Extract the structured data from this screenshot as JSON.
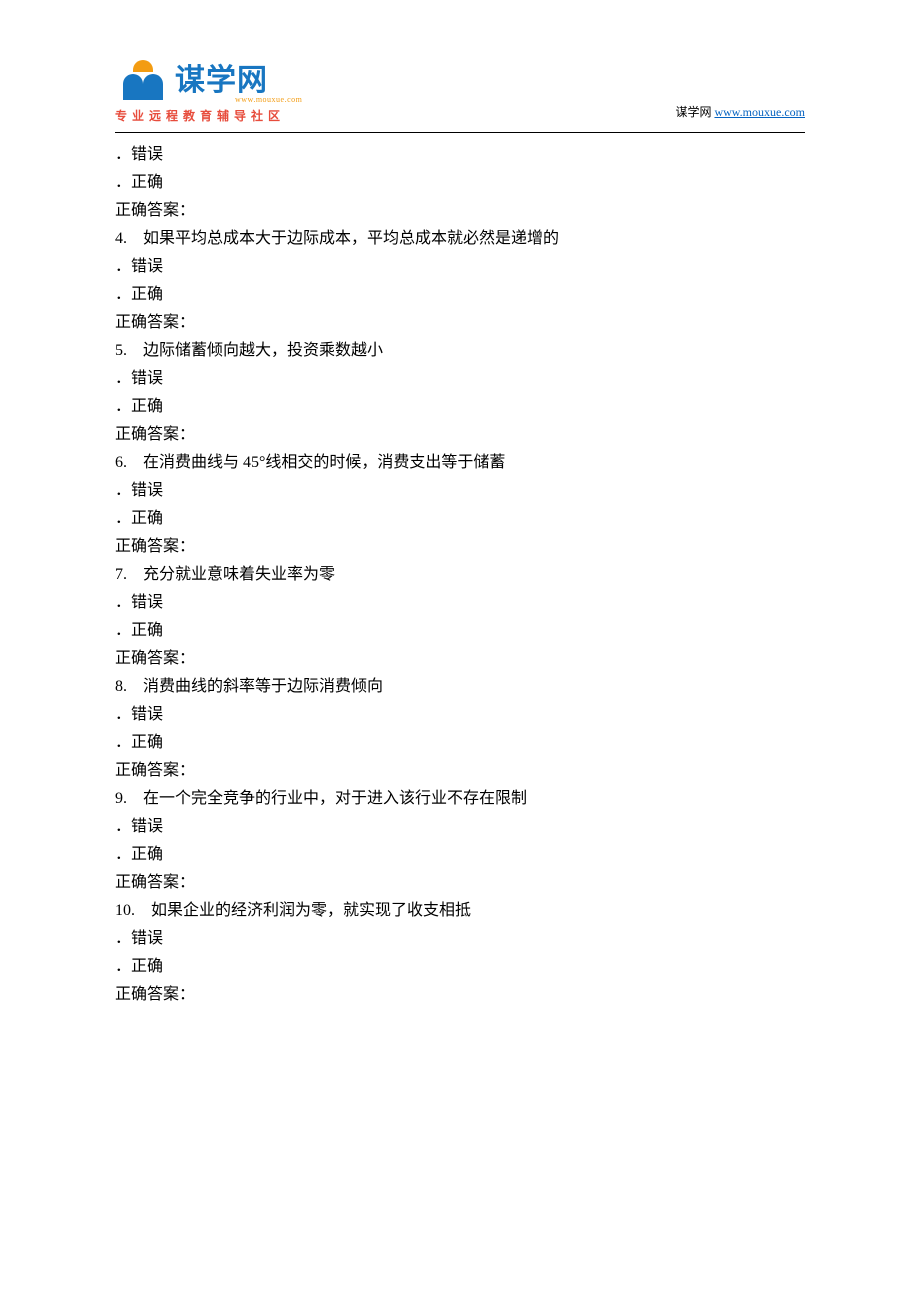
{
  "header": {
    "logo_text": "谋学网",
    "logo_url_small": "www.mouxue.com",
    "tagline": "专业远程教育辅导社区",
    "attribution_prefix": "谋学网 ",
    "attribution_link": "www.mouxue.com"
  },
  "questions": [
    {
      "opt_false": "．错误",
      "opt_true": "．正确",
      "answer_label": "正确答案："
    },
    {
      "stem": "4.　如果平均总成本大于边际成本，平均总成本就必然是递增的",
      "opt_false": "．错误",
      "opt_true": "．正确",
      "answer_label": "正确答案："
    },
    {
      "stem": "5.　边际储蓄倾向越大，投资乘数越小",
      "opt_false": "．错误",
      "opt_true": "．正确",
      "answer_label": "正确答案："
    },
    {
      "stem": "6.　在消费曲线与 45°线相交的时候，消费支出等于储蓄",
      "opt_false": "．错误",
      "opt_true": "．正确",
      "answer_label": "正确答案："
    },
    {
      "stem": "7.　充分就业意味着失业率为零",
      "opt_false": "．错误",
      "opt_true": "．正确",
      "answer_label": "正确答案："
    },
    {
      "stem": "8.　消费曲线的斜率等于边际消费倾向",
      "opt_false": "．错误",
      "opt_true": "．正确",
      "answer_label": "正确答案："
    },
    {
      "stem": "9.　在一个完全竞争的行业中，对于进入该行业不存在限制",
      "opt_false": "．错误",
      "opt_true": "．正确",
      "answer_label": "正确答案："
    },
    {
      "stem": "10.　如果企业的经济利润为零，就实现了收支相抵",
      "opt_false": "．错误",
      "opt_true": "．正确",
      "answer_label": "正确答案："
    }
  ]
}
